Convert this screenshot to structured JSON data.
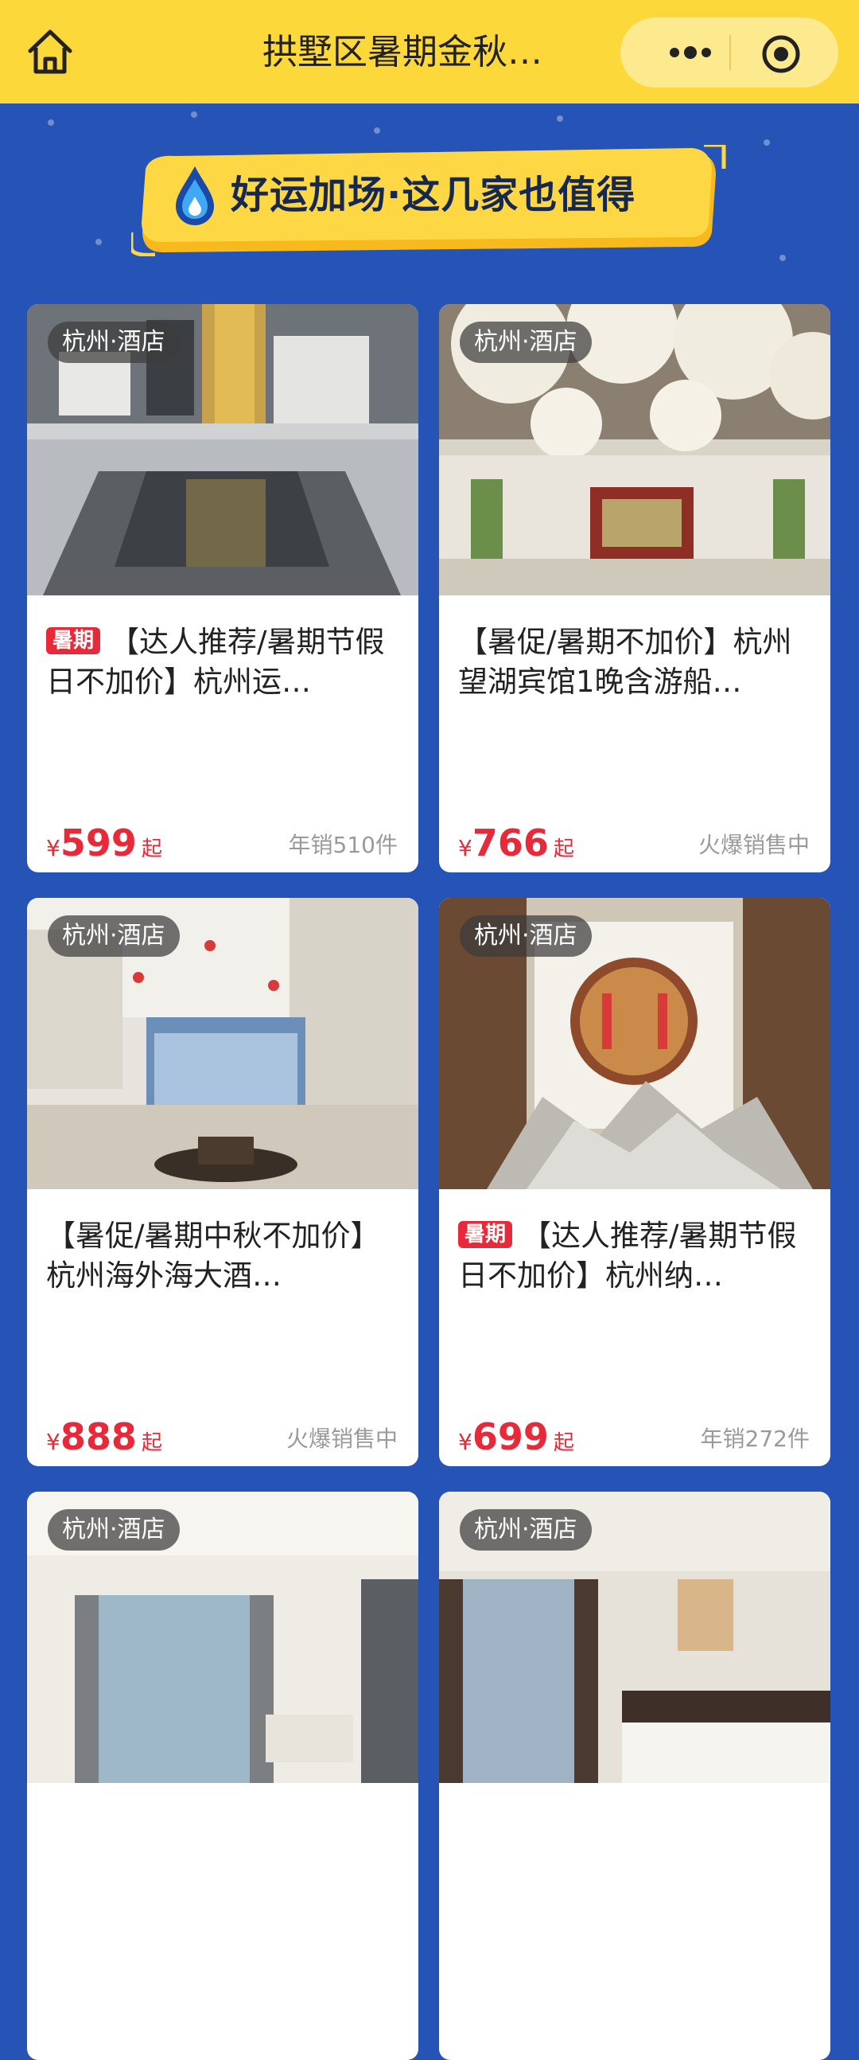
{
  "header": {
    "title": "拱墅区暑期金秋…",
    "home_icon": "home-icon",
    "more_icon": "more-dots-icon",
    "close_icon": "target-circle-icon"
  },
  "banner": {
    "text": "好运加场·这几家也值得",
    "icon": "water-drop-icon"
  },
  "colors": {
    "background": "#2553b6",
    "topbar": "#fdd83a",
    "banner": "#fed744",
    "price": "#e8293a",
    "badge": "#e8293a"
  },
  "cards": [
    {
      "tag": "杭州·酒店",
      "badge": "暑期",
      "title": "【达人推荐/暑期节假日不加价】杭州运…",
      "currency": "¥",
      "price": "599",
      "suffix": "起",
      "sales": "年销510件"
    },
    {
      "tag": "杭州·酒店",
      "badge": "",
      "title": "【暑促/暑期不加价】杭州望湖宾馆1晚含游船…",
      "currency": "¥",
      "price": "766",
      "suffix": "起",
      "sales": "火爆销售中"
    },
    {
      "tag": "杭州·酒店",
      "badge": "",
      "title": "【暑促/暑期中秋不加价】杭州海外海大酒…",
      "currency": "¥",
      "price": "888",
      "suffix": "起",
      "sales": "火爆销售中"
    },
    {
      "tag": "杭州·酒店",
      "badge": "暑期",
      "title": "【达人推荐/暑期节假日不加价】杭州纳…",
      "currency": "¥",
      "price": "699",
      "suffix": "起",
      "sales": "年销272件"
    },
    {
      "tag": "杭州·酒店",
      "badge": "",
      "title": "",
      "currency": "",
      "price": "",
      "suffix": "",
      "sales": ""
    },
    {
      "tag": "杭州·酒店",
      "badge": "",
      "title": "",
      "currency": "",
      "price": "",
      "suffix": "",
      "sales": ""
    }
  ]
}
